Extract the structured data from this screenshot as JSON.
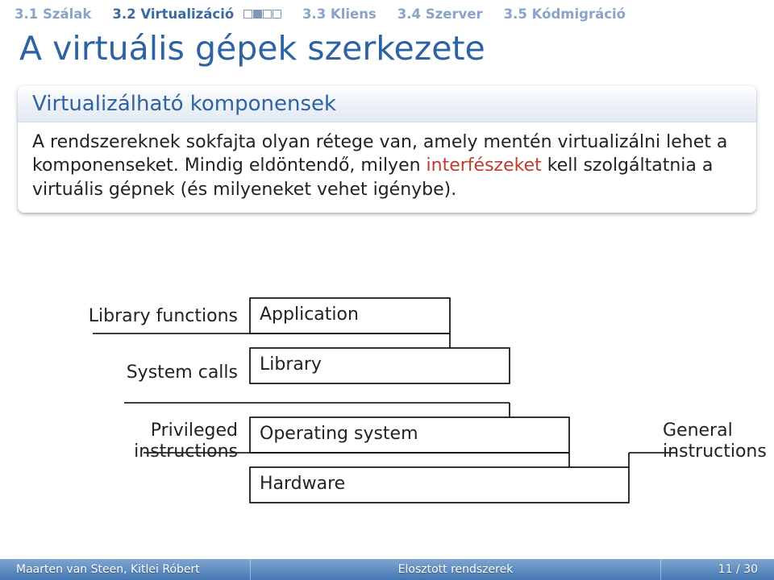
{
  "nav": {
    "items": [
      {
        "label": "3.1 Szálak",
        "active": false,
        "dots": []
      },
      {
        "label": "3.2 Virtualizáció",
        "active": true,
        "dots": [
          "empty",
          "filled",
          "empty",
          "empty"
        ]
      },
      {
        "label": "3.3 Kliens",
        "active": false,
        "dots": []
      },
      {
        "label": "3.4 Szerver",
        "active": false,
        "dots": []
      },
      {
        "label": "3.5 Kódmigráció",
        "active": false,
        "dots": []
      }
    ]
  },
  "title": "A virtuális gépek szerkezete",
  "block": {
    "title": "Virtualizálható komponensek",
    "body_pre": "A rendszereknek sokfajta olyan rétege van, amely mentén virtualizálni lehet a komponenseket. Mindig eldöntendő, milyen ",
    "body_hl": "interfészeket",
    "body_post": " kell szolgáltatnia a virtuális gépnek (és milyeneket vehet igénybe)."
  },
  "diagram": {
    "left_labels": {
      "lib": "Library functions",
      "sys": "System calls",
      "priv1": "Privileged",
      "priv2": "instructions"
    },
    "right_labels": {
      "gen1": "General",
      "gen2": "instructions"
    },
    "boxes": {
      "app": "Application",
      "lib": "Library",
      "os": "Operating system",
      "hw": "Hardware"
    }
  },
  "footer": {
    "authors": "Maarten van Steen, Kitlei Róbert",
    "center": "Elosztott rendszerek",
    "page": "11 / 30"
  }
}
